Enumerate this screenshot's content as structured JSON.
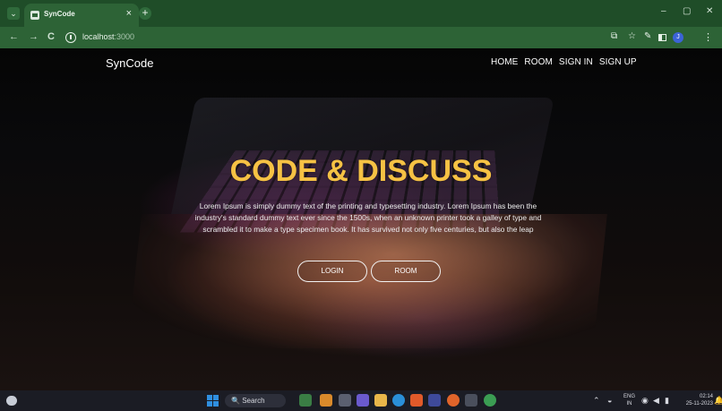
{
  "browser": {
    "tab_title": "SynCode",
    "tab_close": "×",
    "new_tab": "+",
    "tab_menu": "⌄",
    "url_host": "localhost",
    "url_port": ":3000",
    "window_controls": {
      "minimize": "–",
      "restore": "▢",
      "close": "✕"
    },
    "nav": {
      "back": "←",
      "forward": "→",
      "reload": "C"
    },
    "avatar_initial": "J"
  },
  "site": {
    "brand": "SynCode",
    "nav_links": [
      "HOME",
      "ROOM",
      "SIGN IN",
      "SIGN UP"
    ],
    "hero_title": "CODE & DISCUSS",
    "hero_text": "Lorem Ipsum is simply dummy text of the printing and typesetting industry. Lorem Ipsum has been the industry's standard dummy text ever since the 1500s, when an unknown printer took a galley of type and scrambled it to make a type specimen book. It has survived not only five centuries, but also the leap",
    "buttons": {
      "login": "LOGIN",
      "room": "ROOM"
    }
  },
  "taskbar": {
    "search_placeholder": "Search",
    "lang_line1": "ENG",
    "lang_line2": "IN",
    "time": "02:14",
    "date": "25-11-2023"
  },
  "colors": {
    "accent_title": "#f6c244",
    "chrome_green": "#2d6336",
    "taskbar_bg": "#1b1c24"
  },
  "icons": {
    "site_info": "info-icon",
    "cast": "cast-icon",
    "bookmark": "star-icon",
    "extensions": "puzzle-icon",
    "side_panel": "split-icon",
    "menu": "kebab-icon",
    "start": "windows-icon",
    "weather": "cloud-icon"
  }
}
